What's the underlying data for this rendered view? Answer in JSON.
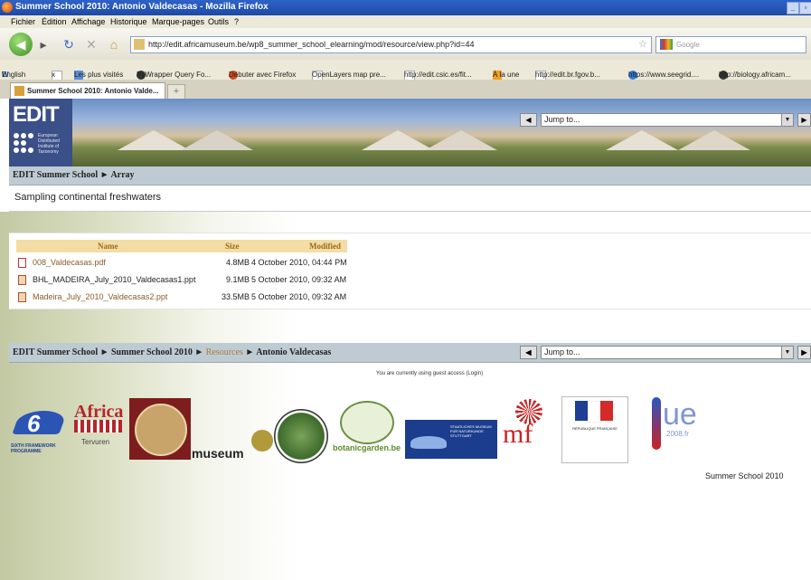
{
  "window": {
    "title": "Summer School 2010: Antonio Valdecasas - Mozilla Firefox"
  },
  "menu": [
    "Fichier",
    "Édition",
    "Affichage",
    "Historique",
    "Marque-pages",
    "Outils",
    "?"
  ],
  "address": {
    "url": "http://edit.africamuseum.be/wp8_summer_school_elearning/mod/resource/view.php?id=44",
    "search_placeholder": "Google"
  },
  "bookmarks": [
    "English",
    "x",
    "Les plus visités",
    "PyWrapper Query Fo...",
    "Débuter avec Firefox",
    "OpenLayers map pre...",
    "http://edit.csic.es/fit...",
    "À la une",
    "http://edit.br.fgov.b...",
    "https://www.seegrid....",
    "http://biology.africam..."
  ],
  "tab": {
    "label": "Summer School 2010: Antonio Valde..."
  },
  "header": {
    "logo_text": "EDIT",
    "logo_subtitle": [
      "European",
      "Distributed",
      "Institute of",
      "Taxonomy"
    ],
    "jump_label": "Jump to..."
  },
  "breadcrumb_top": {
    "home": "EDIT Summer School",
    "current": "Array"
  },
  "page_title": "Sampling continental freshwaters",
  "files": {
    "columns": [
      "Name",
      "Size",
      "Modified"
    ],
    "rows": [
      {
        "name": "008_Valdecasas.pdf",
        "size": "4.8MB",
        "modified": "4 October 2010, 04:44 PM",
        "icon": "pdf-icon"
      },
      {
        "name": "BHL_MADEIRA_July_2010_Valdecasas1.ppt",
        "size": "9.1MB",
        "modified": "5 October 2010, 09:32 AM",
        "icon": "ppt-icon"
      },
      {
        "name": "Madeira_July_2010_Valdecasas2.ppt",
        "size": "33.5MB",
        "modified": "5 October 2010, 09:32 AM",
        "icon": "ppt-icon"
      }
    ]
  },
  "breadcrumb_bottom": {
    "items": [
      "EDIT Summer School",
      "Summer School 2010",
      "Resources",
      "Antonio Valdecasas"
    ],
    "jump_label": "Jump to..."
  },
  "login_notice": "You are currently using guest access (Login)",
  "logos": {
    "sixth_framework": "SIXTH FRAMEWORK PROGRAMME",
    "africa_title": "Africa",
    "africa_sub": "Tervuren",
    "museum": "museum",
    "botanic": "botanicgarden.be",
    "stuttgart": "STAATLICHES MUSEUM FÜR NATURKUNDE STUTTGART",
    "mf": "mf",
    "republique": "RÉPUBLIQUE FRANÇAISE",
    "ue": "ue",
    "ue_sub": "2008.fr"
  },
  "footer": {
    "text": "Summer School 2010"
  },
  "colors": {
    "breadcrumb_bar": "#bfcbd3",
    "table_header": "#f3dda4",
    "link_brown": "#8b5a2b",
    "resources_link": "#b07840"
  }
}
